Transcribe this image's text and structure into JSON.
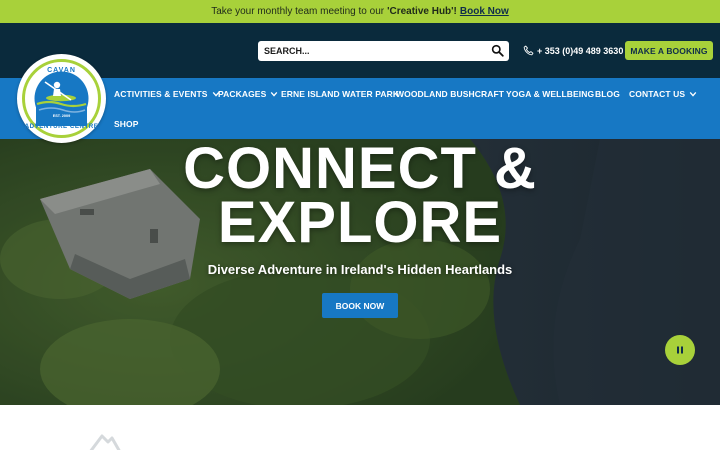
{
  "announcement": {
    "text": "Take your monthly team meeting to our",
    "highlight": "'Creative Hub'!",
    "link": "Book Now"
  },
  "topbar": {
    "search_placeholder": "SEARCH...",
    "phone": "+ 353 (0)49 489 3630",
    "booking_label": "MAKE A BOOKING"
  },
  "logo": {
    "name": "CAVAN ADVENTURE CENTRE",
    "est": "EST. 2009"
  },
  "nav": {
    "items": [
      {
        "label": "ACTIVITIES & EVENTS",
        "dropdown": true
      },
      {
        "label": "PACKAGES",
        "dropdown": true
      },
      {
        "label": "ERNE ISLAND WATER PARK",
        "dropdown": false
      },
      {
        "label": "WOODLAND BUSHCRAFT",
        "dropdown": false
      },
      {
        "label": "YOGA & WELLBEING",
        "dropdown": false
      },
      {
        "label": "BLOG",
        "dropdown": false
      },
      {
        "label": "CONTACT US",
        "dropdown": true
      },
      {
        "label": "SHOP",
        "dropdown": false
      }
    ]
  },
  "hero": {
    "title_line1": "CONNECT &",
    "title_line2": "EXPLORE",
    "subtitle": "Diverse Adventure in Ireland's Hidden Heartlands",
    "button": "BOOK NOW"
  },
  "colors": {
    "accent_green": "#a8d13a",
    "nav_blue": "#1778c4",
    "topbar_navy": "#0a2a3c"
  },
  "icons": [
    "search-icon",
    "phone-icon",
    "chevron-down-icon",
    "pause-icon"
  ]
}
